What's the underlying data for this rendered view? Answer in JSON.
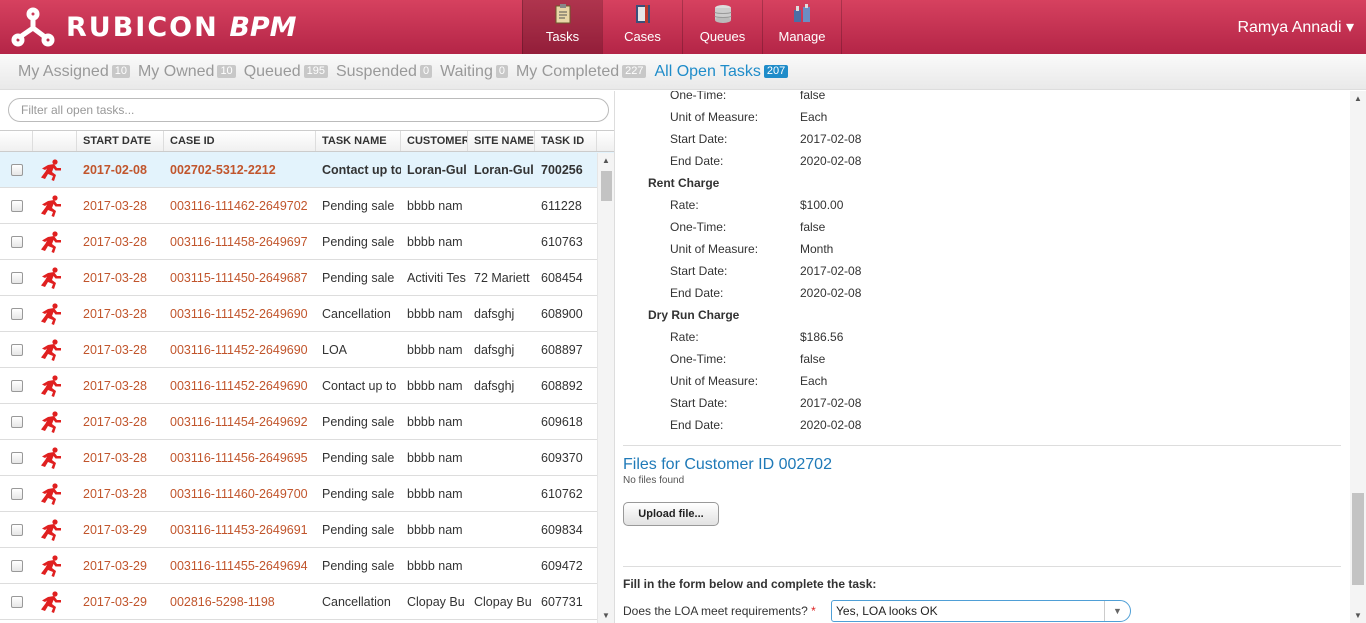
{
  "brand": {
    "name_bold": "RUBICON",
    "name_italic": "BPM"
  },
  "nav": [
    {
      "label": "Tasks",
      "icon": "clipboard-icon",
      "active": true
    },
    {
      "label": "Cases",
      "icon": "binder-icon",
      "active": false
    },
    {
      "label": "Queues",
      "icon": "database-icon",
      "active": false
    },
    {
      "label": "Manage",
      "icon": "tools-icon",
      "active": false
    }
  ],
  "user": {
    "name": "Ramya Annadi ▾"
  },
  "tabs": [
    {
      "label": "My Assigned",
      "count": "10"
    },
    {
      "label": "My Owned",
      "count": "10"
    },
    {
      "label": "Queued",
      "count": "195"
    },
    {
      "label": "Suspended",
      "count": "0"
    },
    {
      "label": "Waiting",
      "count": "0"
    },
    {
      "label": "My Completed",
      "count": "227"
    },
    {
      "label": "All Open Tasks",
      "count": "207",
      "active": true
    }
  ],
  "filter": {
    "placeholder": "Filter all open tasks..."
  },
  "grid": {
    "headers": [
      "",
      "",
      "START DATE",
      "CASE ID",
      "TASK NAME",
      "CUSTOMER",
      "SITE NAME",
      "TASK ID"
    ],
    "rows": [
      {
        "date": "2017-02-08",
        "case": "002702-5312-2212",
        "task": "Contact up to",
        "customer": "Loran-Gul",
        "site": "Loran-Gul",
        "id": "700256",
        "selected": true
      },
      {
        "date": "2017-03-28",
        "case": "003116-111462-2649702",
        "task": "Pending sale",
        "customer": "bbbb nam",
        "site": "",
        "id": "611228"
      },
      {
        "date": "2017-03-28",
        "case": "003116-111458-2649697",
        "task": "Pending sale",
        "customer": "bbbb nam",
        "site": "",
        "id": "610763"
      },
      {
        "date": "2017-03-28",
        "case": "003115-111450-2649687",
        "task": "Pending sale",
        "customer": "Activiti Tes",
        "site": "72 Mariett",
        "id": "608454"
      },
      {
        "date": "2017-03-28",
        "case": "003116-111452-2649690",
        "task": "Cancellation",
        "customer": "bbbb nam",
        "site": "dafsghj",
        "id": "608900"
      },
      {
        "date": "2017-03-28",
        "case": "003116-111452-2649690",
        "task": "LOA",
        "customer": "bbbb nam",
        "site": "dafsghj",
        "id": "608897"
      },
      {
        "date": "2017-03-28",
        "case": "003116-111452-2649690",
        "task": "Contact up to",
        "customer": "bbbb nam",
        "site": "dafsghj",
        "id": "608892"
      },
      {
        "date": "2017-03-28",
        "case": "003116-111454-2649692",
        "task": "Pending sale",
        "customer": "bbbb nam",
        "site": "",
        "id": "609618"
      },
      {
        "date": "2017-03-28",
        "case": "003116-111456-2649695",
        "task": "Pending sale",
        "customer": "bbbb nam",
        "site": "",
        "id": "609370"
      },
      {
        "date": "2017-03-28",
        "case": "003116-111460-2649700",
        "task": "Pending sale",
        "customer": "bbbb nam",
        "site": "",
        "id": "610762"
      },
      {
        "date": "2017-03-29",
        "case": "003116-111453-2649691",
        "task": "Pending sale",
        "customer": "bbbb nam",
        "site": "",
        "id": "609834"
      },
      {
        "date": "2017-03-29",
        "case": "003116-111455-2649694",
        "task": "Pending sale",
        "customer": "bbbb nam",
        "site": "",
        "id": "609472"
      },
      {
        "date": "2017-03-29",
        "case": "002816-5298-1198",
        "task": "Cancellation",
        "customer": "Clopay Bu",
        "site": "Clopay Bu",
        "id": "607731"
      }
    ]
  },
  "details": {
    "top": [
      {
        "k": "One-Time:",
        "v": "false"
      },
      {
        "k": "Unit of Measure:",
        "v": "Each"
      },
      {
        "k": "Start Date:",
        "v": "2017-02-08"
      },
      {
        "k": "End Date:",
        "v": "2020-02-08"
      }
    ],
    "rent_title": "Rent Charge",
    "rent": [
      {
        "k": "Rate:",
        "v": "$100.00"
      },
      {
        "k": "One-Time:",
        "v": "false"
      },
      {
        "k": "Unit of Measure:",
        "v": "Month"
      },
      {
        "k": "Start Date:",
        "v": "2017-02-08"
      },
      {
        "k": "End Date:",
        "v": "2020-02-08"
      }
    ],
    "dry_title": "Dry Run Charge",
    "dry": [
      {
        "k": "Rate:",
        "v": "$186.56"
      },
      {
        "k": "One-Time:",
        "v": "false"
      },
      {
        "k": "Unit of Measure:",
        "v": "Each"
      },
      {
        "k": "Start Date:",
        "v": "2017-02-08"
      },
      {
        "k": "End Date:",
        "v": "2020-02-08"
      }
    ]
  },
  "files": {
    "title": "Files for Customer ID 002702",
    "empty": "No files found",
    "upload_label": "Upload file..."
  },
  "form": {
    "intro": "Fill in the form below and complete the task:",
    "question": "Does the LOA meet requirements?",
    "required_mark": "*",
    "answer": "Yes, LOA looks OK"
  }
}
